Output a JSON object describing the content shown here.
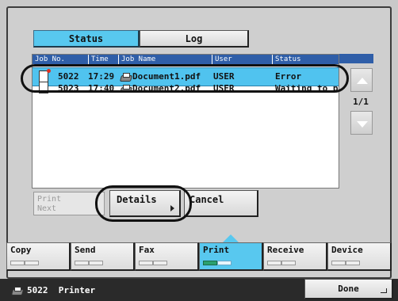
{
  "tabs": {
    "status": "Status",
    "log": "Log"
  },
  "table": {
    "headers": [
      "Job No.",
      "Time",
      "Job Name",
      "User",
      "Status"
    ],
    "rows": [
      {
        "job_no": "5022",
        "time": "17:29",
        "name": "Document1.pdf",
        "user": "USER",
        "status": "Error",
        "selected": true,
        "icon": "document-error-icon"
      },
      {
        "job_no": "5023",
        "time": "17:40",
        "name": "Document2.pdf",
        "user": "USER",
        "status": "Waiting to print",
        "selected": false,
        "icon": "document-icon"
      }
    ]
  },
  "pagination": "1/1",
  "actions": {
    "print_next": "Print\nNext",
    "details": "Details",
    "cancel": "Cancel"
  },
  "functions": [
    "Copy",
    "Send",
    "Fax",
    "Print",
    "Receive",
    "Device"
  ],
  "active_function": "Print",
  "status_bar": {
    "text": "5022  Printer",
    "done": "Done"
  },
  "colors": {
    "accent": "#58c8ef",
    "header": "#2f5ea8",
    "status_bar": "#2a2a2a"
  }
}
